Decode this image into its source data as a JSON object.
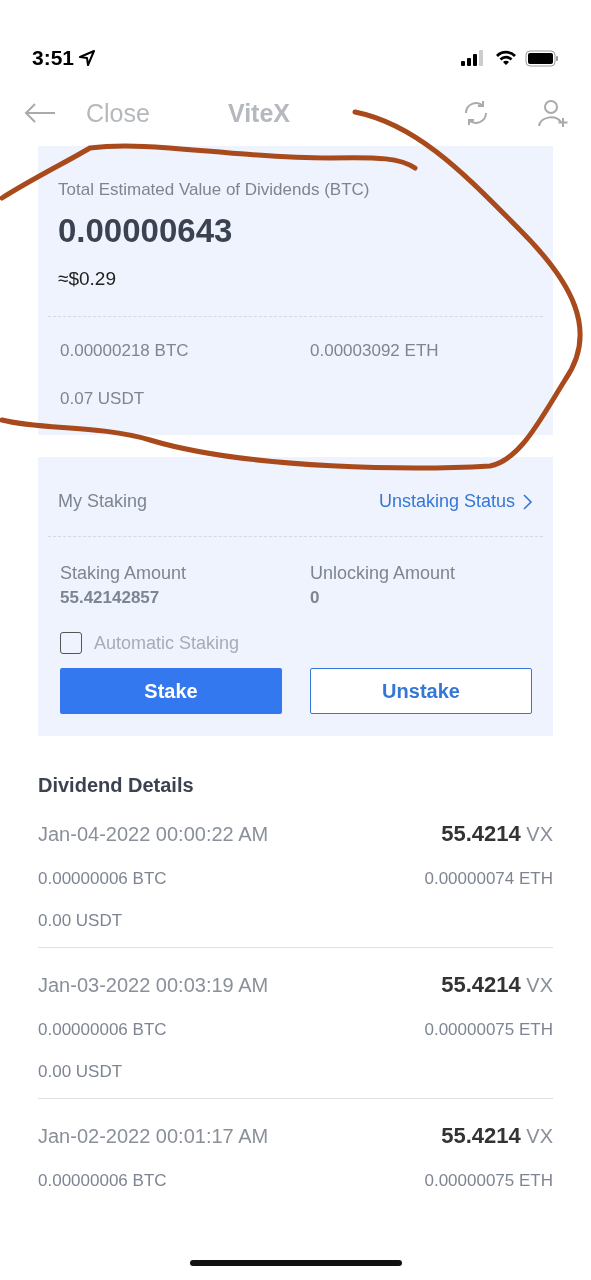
{
  "status_bar": {
    "time": "3:51"
  },
  "nav": {
    "back": "Close",
    "title": "ViteX"
  },
  "summary": {
    "label": "Total Estimated Value of Dividends (BTC)",
    "value": "0.00000643",
    "fiat": "≈$0.29",
    "breakdown": [
      "0.00000218 BTC",
      "0.00003092 ETH",
      "0.07 USDT"
    ]
  },
  "staking": {
    "title": "My Staking",
    "status_link": "Unstaking Status",
    "amounts": [
      {
        "label": "Staking Amount",
        "value": "55.42142857"
      },
      {
        "label": "Unlocking Amount",
        "value": "0"
      }
    ],
    "auto_staking": {
      "label": "Automatic Staking",
      "checked": false
    },
    "buttons": [
      {
        "label": "Stake",
        "kind": "primary"
      },
      {
        "label": "Unstake",
        "kind": "outline"
      }
    ]
  },
  "details": {
    "title": "Dividend Details",
    "rows": [
      {
        "date": "Jan-04-2022 00:00:22 AM",
        "amount": "55.4214",
        "unit": "VX",
        "btc": "0.00000006 BTC",
        "eth": "0.00000074 ETH",
        "usdt": "0.00 USDT"
      },
      {
        "date": "Jan-03-2022 00:03:19 AM",
        "amount": "55.4214",
        "unit": "VX",
        "btc": "0.00000006 BTC",
        "eth": "0.00000075 ETH",
        "usdt": "0.00 USDT"
      },
      {
        "date": "Jan-02-2022 00:01:17 AM",
        "amount": "55.4214",
        "unit": "VX",
        "btc": "0.00000006 BTC",
        "eth": "0.00000075 ETH"
      }
    ]
  }
}
